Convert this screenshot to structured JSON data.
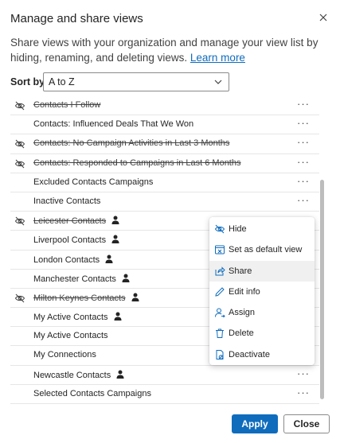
{
  "dialog": {
    "title": "Manage and share views",
    "description": "Share views with your organization and manage your view list by hiding, renaming, and deleting views.",
    "learn_more": "Learn more"
  },
  "sort": {
    "label": "Sort by",
    "value": "A to Z"
  },
  "views": [
    {
      "name": "Contacts I Follow",
      "hidden": true,
      "personal": false,
      "more": true
    },
    {
      "name": "Contacts: Influenced Deals That We Won",
      "hidden": false,
      "personal": false,
      "more": true
    },
    {
      "name": "Contacts: No Campaign Activities in Last 3 Months",
      "hidden": true,
      "personal": false,
      "more": true
    },
    {
      "name": "Contacts: Responded to Campaigns in Last 6 Months",
      "hidden": true,
      "personal": false,
      "more": true
    },
    {
      "name": "Excluded Contacts Campaigns",
      "hidden": false,
      "personal": false,
      "more": true
    },
    {
      "name": "Inactive Contacts",
      "hidden": false,
      "personal": false,
      "more": true
    },
    {
      "name": "Leicester Contacts",
      "hidden": true,
      "personal": true,
      "more": false
    },
    {
      "name": "Liverpool Contacts",
      "hidden": false,
      "personal": true,
      "more": false
    },
    {
      "name": "London Contacts",
      "hidden": false,
      "personal": true,
      "more": false
    },
    {
      "name": "Manchester Contacts",
      "hidden": false,
      "personal": true,
      "more": false
    },
    {
      "name": "Milton Keynes Contacts",
      "hidden": true,
      "personal": true,
      "more": false
    },
    {
      "name": "My Active Contacts",
      "hidden": false,
      "personal": true,
      "more": false
    },
    {
      "name": "My Active Contacts",
      "hidden": false,
      "personal": false,
      "more": false
    },
    {
      "name": "My Connections",
      "hidden": false,
      "personal": false,
      "more": false
    },
    {
      "name": "Newcastle Contacts",
      "hidden": false,
      "personal": true,
      "more": true
    },
    {
      "name": "Selected Contacts Campaigns",
      "hidden": false,
      "personal": false,
      "more": true
    }
  ],
  "more_glyph": "···",
  "context_menu": [
    {
      "label": "Hide",
      "icon": "eye-hide-icon",
      "active": false
    },
    {
      "label": "Set as default view",
      "icon": "default-view-icon",
      "active": false
    },
    {
      "label": "Share",
      "icon": "share-icon",
      "active": true
    },
    {
      "label": "Edit info",
      "icon": "pencil-icon",
      "active": false
    },
    {
      "label": "Assign",
      "icon": "person-assign-icon",
      "active": false
    },
    {
      "label": "Delete",
      "icon": "trash-icon",
      "active": false
    },
    {
      "label": "Deactivate",
      "icon": "document-deactivate-icon",
      "active": false
    }
  ],
  "footer": {
    "apply": "Apply",
    "close": "Close"
  },
  "colors": {
    "accent": "#0f6cbd",
    "menu_active_bg": "#f0f0f0",
    "divider": "#e6e6e6"
  }
}
